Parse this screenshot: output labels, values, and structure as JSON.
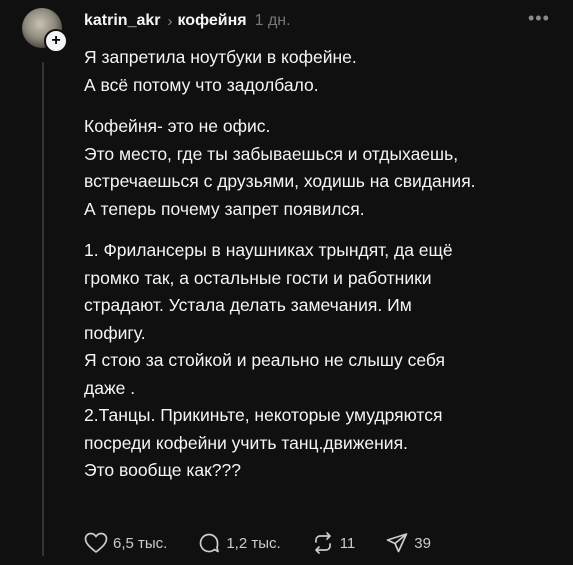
{
  "post": {
    "author": "katrin_akr",
    "community": "кофейня",
    "time": "1 дн.",
    "lines": [
      "Я запретила ноутбуки в кофейне.",
      "А  всё потому что задолбало.",
      "",
      "Кофейня- это не офис.",
      "Это место, где ты забываешься и отдыхаешь,",
      "встречаешься с друзьями, ходишь на свидания.",
      "А теперь  почему запрет появился.",
      "",
      "1. Фрилансеры в наушниках трындят, да ещё",
      "громко так, а остальные гости и работники",
      "страдают. Устала делать замечания. Им",
      "пофигу.",
      "Я стою за стойкой и реально не слышу себя",
      "даже .",
      "2.Танцы. Прикиньте, некоторые умудряются",
      "посреди кофейни учить танц.движения.",
      "Это вообще как???"
    ]
  },
  "actions": {
    "likes": "6,5 тыс.",
    "replies": "1,2 тыс.",
    "reposts": "11",
    "shares": "39"
  },
  "icons": {
    "avatar": "avatar-image",
    "follow": "plus-icon",
    "more": "more-dots-icon",
    "like": "heart-icon",
    "reply": "comment-icon",
    "repost": "repost-icon",
    "share": "send-icon"
  }
}
